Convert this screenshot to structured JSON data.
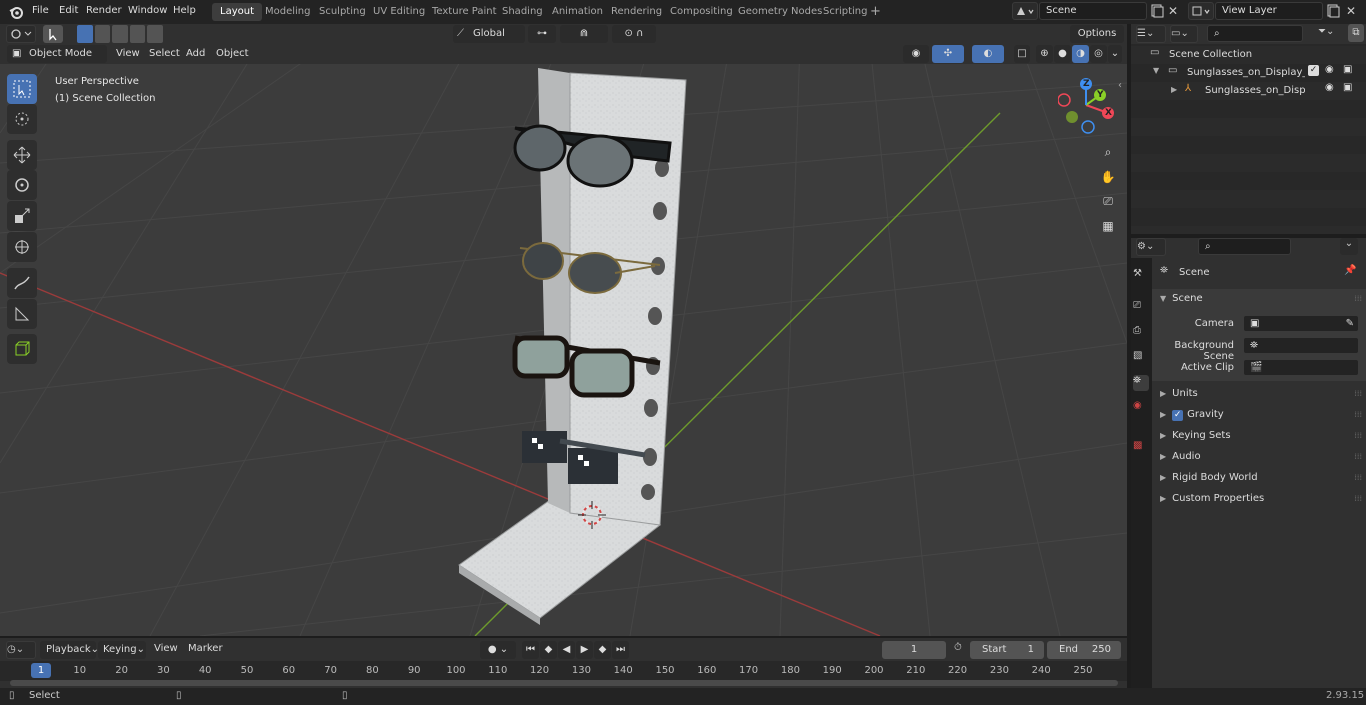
{
  "topbar": {
    "menus": [
      "File",
      "Edit",
      "Render",
      "Window",
      "Help"
    ],
    "workspaces": [
      "Layout",
      "Modeling",
      "Sculpting",
      "UV Editing",
      "Texture Paint",
      "Shading",
      "Animation",
      "Rendering",
      "Compositing",
      "Geometry Nodes",
      "Scripting"
    ],
    "active_workspace": "Layout",
    "scene_name": "Scene",
    "view_layer": "View Layer"
  },
  "viewport_header": {
    "mode": "Object Mode",
    "menus": [
      "View",
      "Select",
      "Add",
      "Object"
    ],
    "orientation": "Global",
    "options_label": "Options"
  },
  "viewport": {
    "perspective_label": "User Perspective",
    "collection_label": "(1) Scene Collection",
    "gizmo_axes": [
      "X",
      "Y",
      "Z"
    ]
  },
  "outliner": {
    "root": "Scene Collection",
    "items": [
      {
        "label": "Sunglasses_on_Display_Stanc",
        "level": 1
      },
      {
        "label": "Sunglasses_on_Display_S",
        "level": 2
      }
    ]
  },
  "properties": {
    "context_title": "Scene",
    "section_title": "Scene",
    "fields": [
      {
        "label": "Camera",
        "value": ""
      },
      {
        "label": "Background Scene",
        "value": ""
      },
      {
        "label": "Active Clip",
        "value": ""
      }
    ],
    "subpanels": [
      "Units",
      "Gravity",
      "Keying Sets",
      "Audio",
      "Rigid Body World",
      "Custom Properties"
    ]
  },
  "timeline": {
    "menus": [
      "Playback",
      "Keying",
      "View",
      "Marker"
    ],
    "current_frame": "1",
    "start_label": "Start",
    "start_value": "1",
    "end_label": "End",
    "end_value": "250",
    "ruler": [
      "1",
      "10",
      "20",
      "30",
      "40",
      "50",
      "60",
      "70",
      "80",
      "90",
      "100",
      "110",
      "120",
      "130",
      "140",
      "150",
      "160",
      "170",
      "180",
      "190",
      "200",
      "210",
      "220",
      "230",
      "240",
      "250"
    ]
  },
  "statusbar": {
    "left": "Select",
    "version": "2.93.15"
  },
  "colors": {
    "accent": "#4772b3",
    "x_axis": "#9b3b3b",
    "y_axis": "#6e9b2c",
    "gizmo_x": "#ef4757",
    "gizmo_y": "#8ad027",
    "gizmo_z": "#3f8ff0"
  }
}
